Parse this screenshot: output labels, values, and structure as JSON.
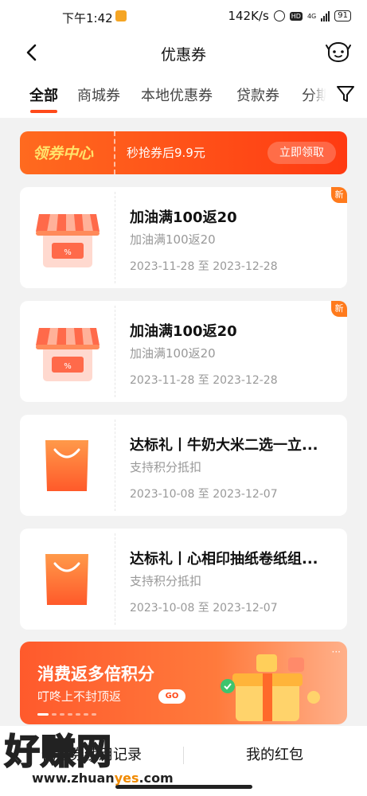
{
  "status_bar": {
    "time": "下午1:42",
    "speed": "142K/s",
    "network": "4G",
    "battery": "91"
  },
  "nav": {
    "title": "优惠券"
  },
  "tabs": [
    {
      "label": "全部",
      "active": true
    },
    {
      "label": "商城券"
    },
    {
      "label": "本地优惠券"
    },
    {
      "label": "贷款券"
    },
    {
      "label": "分期"
    }
  ],
  "top_banner": {
    "label": "领券中心",
    "text": "秒抢券后9.9元",
    "button": "立即领取"
  },
  "coupons": [
    {
      "title": "加油满100返20",
      "subtitle": "加油满100返20",
      "date": "2023-11-28 至 2023-12-28",
      "badge": "新",
      "icon": "shop-icon"
    },
    {
      "title": "加油满100返20",
      "subtitle": "加油满100返20",
      "date": "2023-11-28 至 2023-12-28",
      "badge": "新",
      "icon": "shop-icon"
    },
    {
      "title": "达标礼丨牛奶大米二选一立...",
      "subtitle": "支持积分抵扣",
      "date": "2023-10-08 至 2023-12-07",
      "icon": "shopping-bag-icon"
    },
    {
      "title": "达标礼丨心相印抽纸卷纸组...",
      "subtitle": "支持积分抵扣",
      "date": "2023-10-08 至 2023-12-07",
      "icon": "shopping-bag-icon"
    }
  ],
  "promo": {
    "title": "消费返多倍积分",
    "subtitle": "叮咚上不封顶返",
    "go": "GO"
  },
  "bottom_bar": {
    "left": "优惠券使用记录",
    "right": "我的红包"
  },
  "watermark": {
    "main": "好赚网",
    "url_pre": "www.zhuan",
    "url_mid": "yes",
    "url_post": ".com"
  },
  "colors": {
    "accent": "#ff4a1a",
    "badge": "#ff7a1c"
  }
}
